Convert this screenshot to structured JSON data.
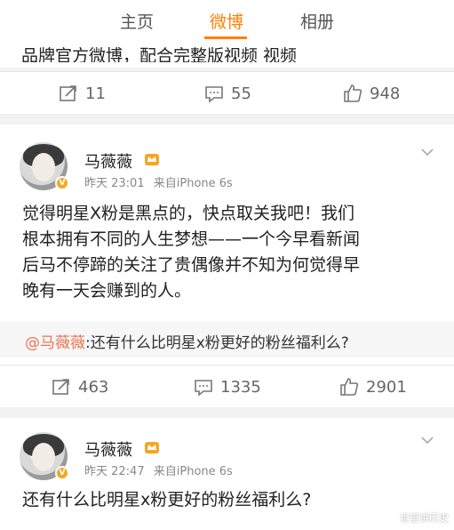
{
  "tabs": [
    {
      "label": "主页"
    },
    {
      "label": "微博"
    },
    {
      "label": "相册"
    }
  ],
  "prev_post": {
    "cut_text": "品牌官方微博，配合完整版视频      视频",
    "actions": {
      "repost": "11",
      "comment": "55",
      "like": "948"
    }
  },
  "post1": {
    "author": "马薇薇",
    "verified_badge": "V",
    "time": "昨天 23:01",
    "source": "来自iPhone 6s",
    "lines": [
      "觉得明星X粉是黑点的，快点取关我吧！我们",
      "根本拥有不同的人生梦想——一个今早看新闻",
      "后马不停蹄的关注了贵偶像并不知为何觉得早",
      "晚有一天会赚到的人。"
    ],
    "repost_quote": {
      "mention": "@马薇薇",
      "text": ":还有什么比明星x粉更好的粉丝福利么?"
    },
    "actions": {
      "repost": "463",
      "comment": "1335",
      "like": "2901"
    }
  },
  "post2": {
    "author": "马薇薇",
    "verified_badge": "V",
    "time": "昨天 22:47",
    "source": "来自iPhone 6s",
    "text": "还有什么比明星x粉更好的粉丝福利么?"
  },
  "watermark": "食堂讲历史",
  "colors": {
    "accent": "#ff8200",
    "mention": "#eb7350",
    "badge": "#f5a623"
  }
}
